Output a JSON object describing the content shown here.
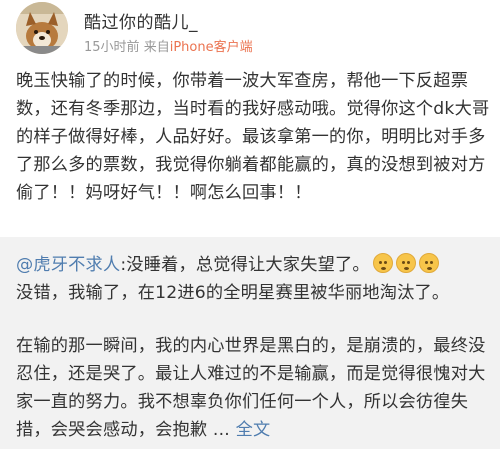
{
  "post": {
    "username": "酷过你的酷儿_",
    "time": "15小时前",
    "source_prefix": "来自",
    "source": "iPhone客户端",
    "text": "晚玉快输了的时候，你带着一波大军查房，帮他一下反超票数，还有冬季那边，当时看的我好感动哦。觉得你这个dk大哥的样子做得好棒，人品好好。最该拿第一的你，明明比对手多了那么多的票数，我觉得你躺着都能赢的，真的没想到被对方偷了！！妈呀好气！！啊怎么回事！！"
  },
  "repost": {
    "mention": "@虎牙不求人",
    "text": ":没睡着，总觉得让大家失望了。",
    "emoji_icons": [
      "pensive-face-icon",
      "pensive-face-icon",
      "pensive-face-icon"
    ],
    "text2": "没错，我输了，在12进6的全明星赛里被华丽地淘汰了。",
    "paragraph": "在输的那一瞬间，我的内心世界是黑白的，是崩溃的，最终没忍住，还是哭了。最让人难过的不是输赢，而是觉得很愧对大家一直的努力。我不想辜负你们任何一个人，所以会彷徨失措，会哭会感动，会抱歉 ...",
    "full_text_link": "全文"
  }
}
